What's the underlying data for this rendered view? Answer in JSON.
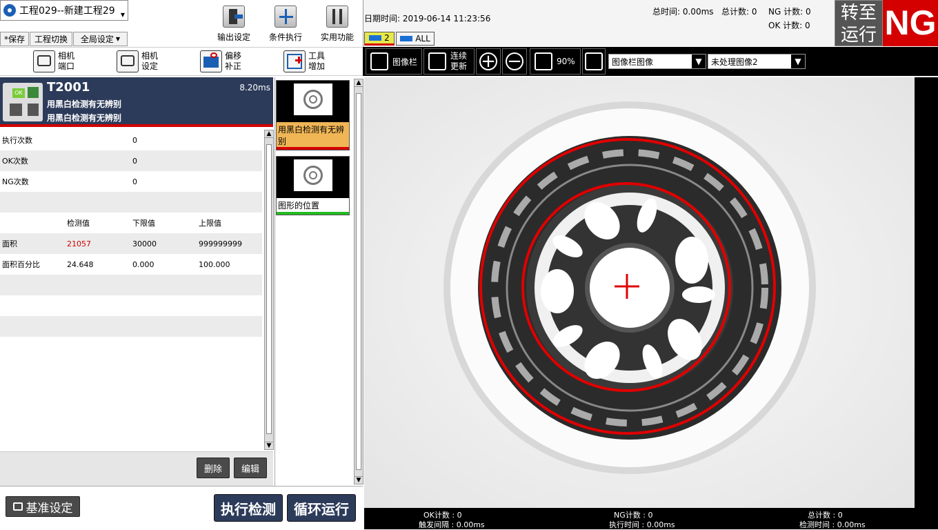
{
  "project": {
    "title": "工程029--新建工程29"
  },
  "menu": {
    "save": "*保存",
    "switch": "工程切换",
    "global": "全局设定"
  },
  "toolbar": {
    "output": "输出设定",
    "condition": "条件执行",
    "utility": "实用功能"
  },
  "tools2": [
    {
      "l1": "相机",
      "l2": "端口"
    },
    {
      "l1": "相机",
      "l2": "设定"
    },
    {
      "l1": "偏移",
      "l2": "补正"
    },
    {
      "l1": "工具",
      "l2": "增加"
    }
  ],
  "header": {
    "datetime_label": "日期时间:",
    "datetime": "2019-06-14 11:23:56",
    "total_time": "总时间: 0.00ms",
    "total_count": "总计数: 0",
    "ng_count": "NG 计数: 0",
    "ok_count": "OK 计数: 0"
  },
  "run": {
    "line1": "转至",
    "line2": "运行",
    "result": "NG"
  },
  "tabs": {
    "cam": "2",
    "all": "ALL"
  },
  "imgbar": {
    "image_bar": "图像栏",
    "continuous_l1": "连续",
    "continuous_l2": "更新",
    "zoom": "90%",
    "select1": "图像栏图像",
    "select2": "未处理图像2"
  },
  "tool": {
    "id": "T2001",
    "time": "8.20ms",
    "desc1": "用黑白检测有无辨别",
    "desc2": "用黑白检测有无辨别",
    "icon_text": "OK"
  },
  "stats": [
    {
      "label": "执行次数",
      "value": "0"
    },
    {
      "label": "OK次数",
      "value": "0"
    },
    {
      "label": "NG次数",
      "value": "0"
    }
  ],
  "table": {
    "headers": [
      "检测值",
      "下限值",
      "上限值"
    ],
    "rows": [
      {
        "name": "面积",
        "value": "21057",
        "low": "30000",
        "high": "999999999",
        "value_color": "#d40000"
      },
      {
        "name": "面积百分比",
        "value": "24.648",
        "low": "0.000",
        "high": "100.000",
        "value_color": "#000000"
      }
    ]
  },
  "buttons": {
    "delete": "删除",
    "edit": "编辑",
    "base": "基准设定",
    "exec": "执行检测",
    "loop": "循环运行"
  },
  "thumbs": [
    {
      "label": "用黑白检测有无辨别",
      "bg": "#f0b656",
      "bar": "#d40000"
    },
    {
      "label": "图形的位置",
      "bg": "#ffffff",
      "bar": "#22bb22"
    }
  ],
  "status": {
    "ok": "OK计数 : 0",
    "interval": "触发间隔 : 0.00ms",
    "ng": "NG计数 : 0",
    "exec_time": "执行时间 : 0.00ms",
    "total": "总计数 : 0",
    "detect_time": "检测时间 : 0.00ms"
  }
}
